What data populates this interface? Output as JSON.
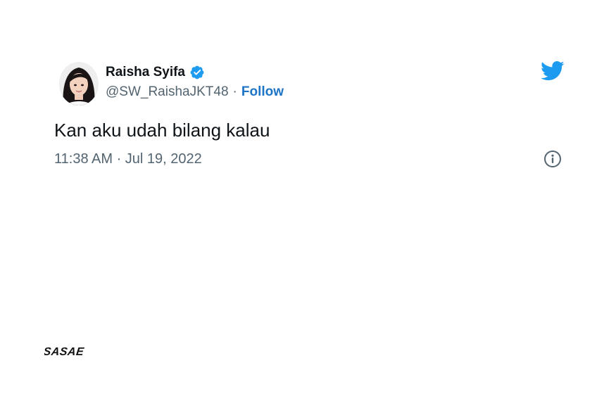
{
  "author": {
    "display_name": "Raisha Syifa",
    "handle": "@SW_RaishaJKT48",
    "separator": "·",
    "follow_label": "Follow",
    "verified": true
  },
  "tweet": {
    "text": "Kan aku udah bilang kalau",
    "timestamp": "11:38 AM · Jul 19, 2022"
  },
  "icons": {
    "brand": "twitter-bird-icon",
    "verified": "verified-badge-icon",
    "info": "info-icon"
  },
  "watermark": {
    "text": "SASAE"
  },
  "colors": {
    "twitter_blue": "#1d9bf0",
    "follow_blue": "#1d74c7",
    "text_primary": "#0f1419",
    "text_secondary": "#536471"
  }
}
